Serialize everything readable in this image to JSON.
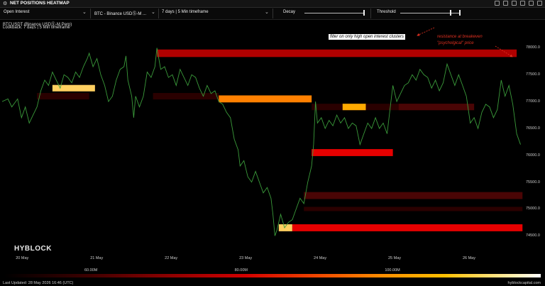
{
  "window": {
    "title": "NET POSITIONS HEATMAP",
    "icons": [
      "refresh-icon",
      "expand-icon",
      "camera-icon",
      "download-icon",
      "fullscreen-icon",
      "close-icon"
    ]
  },
  "controls": {
    "metric": "Open Interest",
    "symbol": "BTC - Binance USDⓈ-M ...",
    "lookback": "7 days | 5 Min timeframe",
    "decay_label": "Decay",
    "threshold_label": "Threshold"
  },
  "chart": {
    "instrument": "BTCUSDT (Binance USDⓈ-M Perp)",
    "lookback": "Lookback: 7 days | 5 Min timeframe",
    "watermark": "HYBLOCK",
    "annotation_filter": "filter on only high open interest clusters",
    "annotation_resistance_1": "resistance at breakeven",
    "annotation_resistance_2": "\"psycholgical\" price",
    "annotation_color": "#e03020"
  },
  "chart_data": {
    "type": "heatmap",
    "y_ticks": [
      "78000.0",
      "77500.0",
      "77000.0",
      "76500.0",
      "76000.0",
      "75500.0",
      "75000.0",
      "74500.0"
    ],
    "x_ticks": [
      "20 May",
      "21 May",
      "22 May",
      "23 May",
      "24 May",
      "25 May",
      "26 May"
    ],
    "ylim": [
      74200,
      78350
    ],
    "colorbar_ticks": [
      "60.00M",
      "80.00M",
      "100.00M"
    ],
    "price_line": [
      [
        0.0,
        77000
      ],
      [
        0.3,
        77050
      ],
      [
        0.5,
        76900
      ],
      [
        0.8,
        77050
      ],
      [
        1.0,
        76700
      ],
      [
        1.2,
        76900
      ],
      [
        1.4,
        76600
      ],
      [
        1.6,
        76750
      ],
      [
        1.8,
        76900
      ],
      [
        2.0,
        77200
      ],
      [
        2.2,
        77400
      ],
      [
        2.4,
        77300
      ],
      [
        2.6,
        77550
      ],
      [
        2.8,
        77400
      ],
      [
        3.0,
        77250
      ],
      [
        3.2,
        77500
      ],
      [
        3.4,
        77450
      ],
      [
        3.6,
        77350
      ],
      [
        3.8,
        77550
      ],
      [
        4.0,
        77450
      ],
      [
        4.2,
        77650
      ],
      [
        4.4,
        77800
      ],
      [
        4.5,
        77900
      ],
      [
        4.7,
        77650
      ],
      [
        4.9,
        77800
      ],
      [
        5.1,
        77500
      ],
      [
        5.3,
        77300
      ],
      [
        5.5,
        77000
      ],
      [
        5.7,
        77100
      ],
      [
        5.9,
        77400
      ],
      [
        6.1,
        77600
      ],
      [
        6.3,
        77650
      ],
      [
        6.4,
        77850
      ],
      [
        6.5,
        77400
      ],
      [
        6.7,
        77100
      ],
      [
        6.8,
        76700
      ],
      [
        6.9,
        77100
      ],
      [
        7.1,
        76900
      ],
      [
        7.3,
        77100
      ],
      [
        7.5,
        77550
      ],
      [
        7.7,
        77450
      ],
      [
        7.9,
        77650
      ],
      [
        8.0,
        78000
      ],
      [
        8.2,
        77600
      ],
      [
        8.4,
        77650
      ],
      [
        8.6,
        77450
      ],
      [
        8.8,
        77500
      ],
      [
        9.0,
        77300
      ],
      [
        9.2,
        77600
      ],
      [
        9.4,
        77450
      ],
      [
        9.6,
        77300
      ],
      [
        9.8,
        77500
      ],
      [
        10.0,
        77450
      ],
      [
        10.2,
        77250
      ],
      [
        10.4,
        77100
      ],
      [
        10.6,
        77300
      ],
      [
        10.8,
        77150
      ],
      [
        11.0,
        77200
      ],
      [
        11.2,
        77000
      ],
      [
        11.4,
        76950
      ],
      [
        11.6,
        76800
      ],
      [
        11.8,
        76700
      ],
      [
        11.9,
        76500
      ],
      [
        12.0,
        76300
      ],
      [
        12.2,
        76100
      ],
      [
        12.3,
        75800
      ],
      [
        12.5,
        75900
      ],
      [
        12.7,
        75600
      ],
      [
        12.9,
        75500
      ],
      [
        13.1,
        75700
      ],
      [
        13.3,
        75500
      ],
      [
        13.5,
        75300
      ],
      [
        13.7,
        75400
      ],
      [
        13.9,
        75200
      ],
      [
        14.0,
        74900
      ],
      [
        14.1,
        74500
      ],
      [
        14.2,
        74600
      ],
      [
        14.3,
        74750
      ],
      [
        14.4,
        74900
      ],
      [
        14.6,
        74650
      ],
      [
        14.8,
        74750
      ],
      [
        15.0,
        74800
      ],
      [
        15.2,
        75000
      ],
      [
        15.4,
        75200
      ],
      [
        15.6,
        75100
      ],
      [
        15.8,
        75500
      ],
      [
        16.0,
        75800
      ],
      [
        16.1,
        76200
      ],
      [
        16.2,
        77000
      ],
      [
        16.3,
        76600
      ],
      [
        16.5,
        76700
      ],
      [
        16.7,
        76500
      ],
      [
        16.9,
        76650
      ],
      [
        17.1,
        76550
      ],
      [
        17.3,
        76750
      ],
      [
        17.5,
        76600
      ],
      [
        17.7,
        76700
      ],
      [
        17.9,
        76500
      ],
      [
        18.1,
        76600
      ],
      [
        18.3,
        76550
      ],
      [
        18.5,
        76200
      ],
      [
        18.7,
        76400
      ],
      [
        18.9,
        76600
      ],
      [
        19.1,
        76500
      ],
      [
        19.3,
        76700
      ],
      [
        19.5,
        76500
      ],
      [
        19.7,
        76600
      ],
      [
        19.9,
        76400
      ],
      [
        20.1,
        77000
      ],
      [
        20.2,
        77300
      ],
      [
        20.4,
        77000
      ],
      [
        20.6,
        77150
      ],
      [
        20.8,
        77300
      ],
      [
        21.0,
        77350
      ],
      [
        21.2,
        77500
      ],
      [
        21.4,
        77400
      ],
      [
        21.6,
        77600
      ],
      [
        21.8,
        77500
      ],
      [
        22.0,
        77450
      ],
      [
        22.2,
        77250
      ],
      [
        22.4,
        77400
      ],
      [
        22.6,
        77200
      ],
      [
        22.8,
        77350
      ],
      [
        23.0,
        77700
      ],
      [
        23.2,
        77500
      ],
      [
        23.4,
        77300
      ],
      [
        23.6,
        77500
      ],
      [
        23.8,
        77300
      ],
      [
        24.0,
        77100
      ],
      [
        24.2,
        76600
      ],
      [
        24.4,
        76700
      ],
      [
        24.6,
        76500
      ],
      [
        24.8,
        76800
      ],
      [
        25.0,
        76950
      ],
      [
        25.2,
        76900
      ],
      [
        25.4,
        76700
      ],
      [
        25.6,
        76850
      ],
      [
        25.8,
        77400
      ],
      [
        26.0,
        77100
      ],
      [
        26.2,
        77300
      ],
      [
        26.4,
        76950
      ],
      [
        26.6,
        76400
      ],
      [
        26.8,
        76200
      ]
    ],
    "clusters": [
      {
        "x0": 1.8,
        "x1": 4.5,
        "y": 77100,
        "h": 120,
        "tone": "dark"
      },
      {
        "x0": 2.6,
        "x1": 4.8,
        "y": 77250,
        "h": 120,
        "tone": "gold"
      },
      {
        "x0": 8.0,
        "x1": 26.6,
        "y": 77900,
        "h": 140,
        "tone": "red"
      },
      {
        "x0": 7.8,
        "x1": 11.2,
        "y": 77100,
        "h": 120,
        "tone": "dark"
      },
      {
        "x0": 11.2,
        "x1": 16.0,
        "y": 77050,
        "h": 130,
        "tone": "orange"
      },
      {
        "x0": 16.0,
        "x1": 24.4,
        "y": 76900,
        "h": 120,
        "tone": "dark"
      },
      {
        "x0": 17.6,
        "x1": 18.8,
        "y": 76900,
        "h": 120,
        "tone": "amber"
      },
      {
        "x0": 20.5,
        "x1": 24.4,
        "y": 76900,
        "h": 120,
        "tone": "maroon"
      },
      {
        "x0": 16.0,
        "x1": 20.2,
        "y": 76050,
        "h": 130,
        "tone": "brightred"
      },
      {
        "x0": 15.6,
        "x1": 26.9,
        "y": 75250,
        "h": 130,
        "tone": "maroon"
      },
      {
        "x0": 15.6,
        "x1": 26.9,
        "y": 75000,
        "h": 80,
        "tone": "dark"
      },
      {
        "x0": 14.3,
        "x1": 15.0,
        "y": 74650,
        "h": 130,
        "tone": "gold"
      },
      {
        "x0": 15.0,
        "x1": 26.9,
        "y": 74650,
        "h": 130,
        "tone": "brightred"
      }
    ]
  },
  "footer": {
    "last_updated": "Last Updated: 28 May 2026 16:46 (UTC)",
    "site": "hyblockcapital.com"
  }
}
